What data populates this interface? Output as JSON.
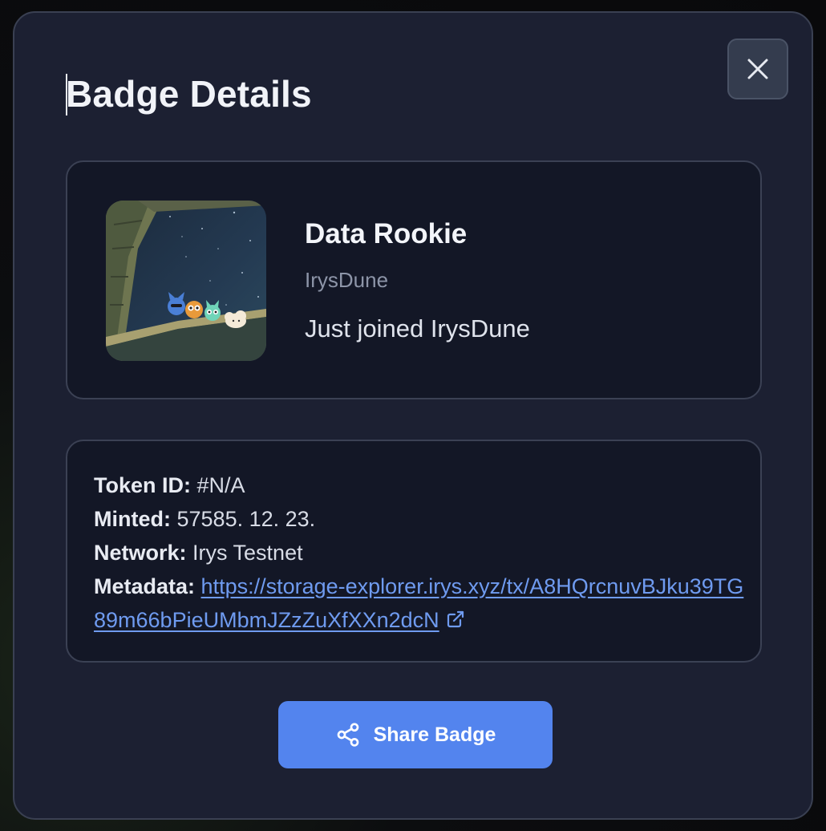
{
  "modal": {
    "title": "Badge Details",
    "close_icon": "close-icon"
  },
  "badge": {
    "name": "Data Rookie",
    "issuer": "IrysDune",
    "description": "Just joined IrysDune",
    "image_icon": "badge-artwork"
  },
  "details": {
    "token_id_label": "Token ID:",
    "token_id_value": "#N/A",
    "minted_label": "Minted:",
    "minted_value": "57585. 12. 23.",
    "network_label": "Network:",
    "network_value": "Irys Testnet",
    "metadata_label": "Metadata:",
    "metadata_url_line1": "https://storage-explorer.irys.xyz/tx/A8HQrcnuvBJku39TG",
    "metadata_url_line2": "89m66bPieUMbmJZzZuXfXXn2dcN",
    "external_link_icon": "external-link-icon"
  },
  "share": {
    "label": "Share Badge",
    "icon": "share-icon"
  },
  "colors": {
    "modal_bg": "#1c2032",
    "card_bg": "#131726",
    "accent": "#5384ee",
    "link": "#6f9bf0"
  }
}
